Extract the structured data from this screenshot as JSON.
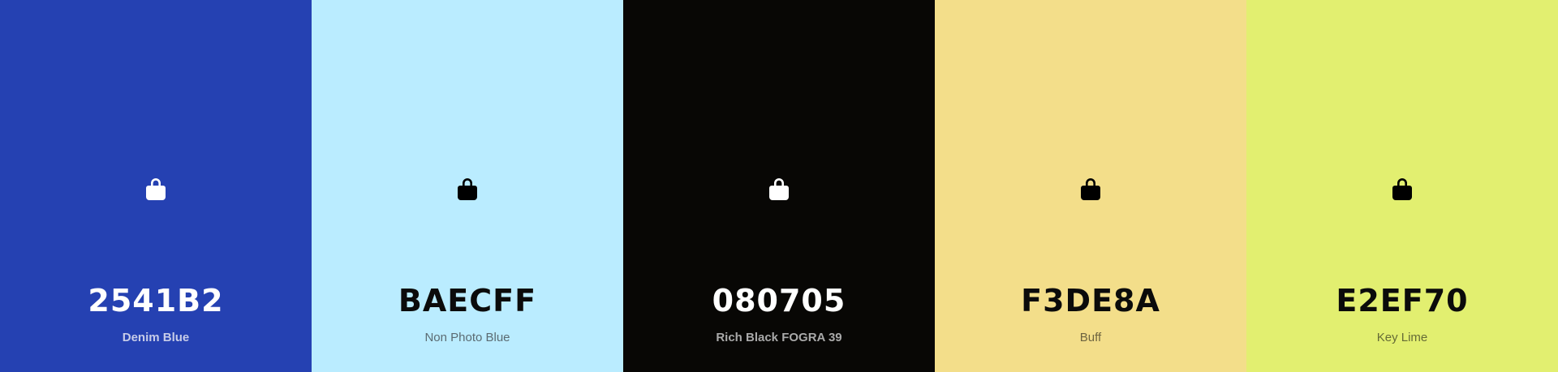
{
  "palette": {
    "swatches": [
      {
        "hex": "2541B2",
        "name": "Denim Blue",
        "background": "#2541B2",
        "theme": "dark",
        "name_color": "#C7CCE8",
        "name_weight": "700",
        "lock_icon": "lock-icon"
      },
      {
        "hex": "BAECFF",
        "name": "Non Photo Blue",
        "background": "#BAECFF",
        "theme": "light",
        "name_color": "#5B6B72",
        "name_weight": "400",
        "lock_icon": "lock-icon"
      },
      {
        "hex": "080705",
        "name": "Rich Black FOGRA 39",
        "background": "#080705",
        "theme": "dark",
        "name_color": "#A9A9A9",
        "name_weight": "700",
        "lock_icon": "lock-icon"
      },
      {
        "hex": "F3DE8A",
        "name": "Buff",
        "background": "#F3DE8A",
        "theme": "light",
        "name_color": "#6D6440",
        "name_weight": "400",
        "lock_icon": "lock-icon"
      },
      {
        "hex": "E2EF70",
        "name": "Key Lime",
        "background": "#E2EF70",
        "theme": "light",
        "name_color": "#656B36",
        "name_weight": "400",
        "lock_icon": "lock-icon"
      }
    ]
  }
}
